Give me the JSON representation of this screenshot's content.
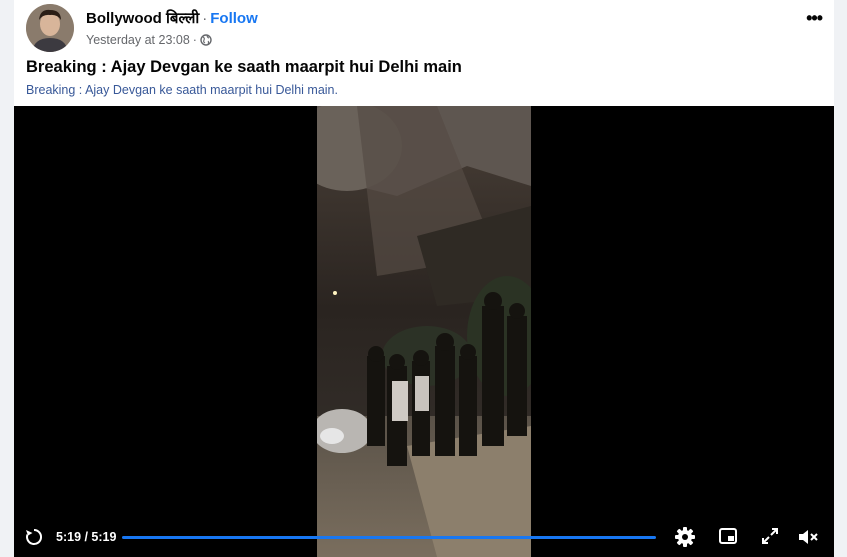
{
  "post": {
    "author": "Bollywood बिल्ली",
    "separator": "·",
    "follow_label": "Follow",
    "timestamp": "Yesterday at 23:08",
    "separator2": "·",
    "more_label": "•••",
    "title": "Breaking : Ajay Devgan ke saath maarpit hui Delhi main",
    "subtitle": "Breaking : Ajay Devgan ke saath maarpit hui Delhi main."
  },
  "video": {
    "time_display": "5:19 / 5:19",
    "progress": 1.0,
    "icons": [
      "replay-icon",
      "settings-icon",
      "picture-in-picture-icon",
      "fullscreen-icon",
      "volume-muted-icon"
    ]
  },
  "colors": {
    "accent": "#1877f2",
    "video_bg": "#000000",
    "text_secondary": "#65676b"
  }
}
